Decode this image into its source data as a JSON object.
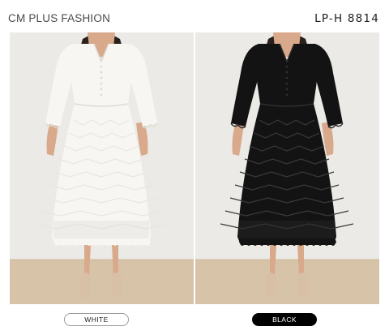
{
  "header": {
    "brand": "CM PLUS FASHION",
    "product_code": "LP-H 8814"
  },
  "variants": [
    {
      "label": "WHITE",
      "color": "#ffffff",
      "dress_color": "#f7f6f3",
      "selected": false
    },
    {
      "label": "BLACK",
      "color": "#000000",
      "dress_color": "#131313",
      "selected": true
    }
  ],
  "colors": {
    "wall": "#eceae6",
    "floor": "#d6c3a8",
    "skin": "#d9a98c",
    "hair": "#2b211c",
    "shoes": "#d8c0a6"
  },
  "icons": {
    "white_model": "white-lace-dress-model-photo",
    "black_model": "black-lace-dress-model-photo"
  }
}
